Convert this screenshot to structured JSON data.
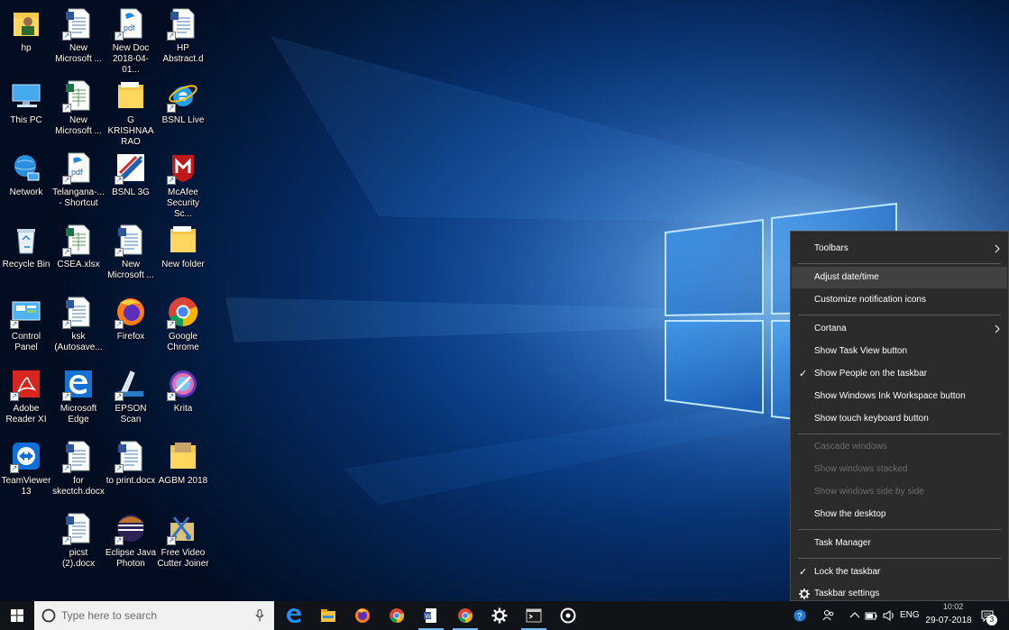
{
  "desktop": {
    "icons": [
      {
        "label": "hp",
        "icon": "user-folder-icon"
      },
      {
        "label": "This PC",
        "icon": "computer-icon"
      },
      {
        "label": "Network",
        "icon": "network-globe-icon"
      },
      {
        "label": "Recycle Bin",
        "icon": "recycle-bin-icon"
      },
      {
        "label": "Control Panel",
        "icon": "control-panel-icon"
      },
      {
        "label": "Adobe Reader XI",
        "icon": "adobe-reader-icon"
      },
      {
        "label": "TeamViewer 13",
        "icon": "teamviewer-icon"
      },
      {
        "label": "New Microsoft ...",
        "icon": "word-document-icon"
      },
      {
        "label": "New Microsoft ...",
        "icon": "excel-document-icon"
      },
      {
        "label": "Telangana-... - Shortcut",
        "icon": "pdf-document-icon"
      },
      {
        "label": "CSEA.xlsx",
        "icon": "excel-document-icon"
      },
      {
        "label": "ksk (Autosave...",
        "icon": "word-document-icon"
      },
      {
        "label": "Microsoft Edge",
        "icon": "edge-icon"
      },
      {
        "label": "for skectch.docx",
        "icon": "word-document-icon"
      },
      {
        "label": "picst (2).docx",
        "icon": "word-document-icon"
      },
      {
        "label": "New Doc 2018-04-01...",
        "icon": "pdf-document-icon"
      },
      {
        "label": "G KRISHNAA RAO",
        "icon": "folder-icon"
      },
      {
        "label": "BSNL 3G",
        "icon": "bsnl-icon"
      },
      {
        "label": "New Microsoft ...",
        "icon": "word-document-icon"
      },
      {
        "label": "Firefox",
        "icon": "firefox-icon"
      },
      {
        "label": "EPSON Scan",
        "icon": "scanner-icon"
      },
      {
        "label": "to print.docx",
        "icon": "word-document-icon"
      },
      {
        "label": "Eclipse Java Photon",
        "icon": "eclipse-icon"
      },
      {
        "label": "HP Abstract.d",
        "icon": "word-document-icon"
      },
      {
        "label": "BSNL Live",
        "icon": "ie-icon"
      },
      {
        "label": "McAfee Security Sc...",
        "icon": "mcafee-icon"
      },
      {
        "label": "New folder",
        "icon": "folder-icon"
      },
      {
        "label": "Google Chrome",
        "icon": "chrome-icon"
      },
      {
        "label": "Krita",
        "icon": "krita-icon"
      },
      {
        "label": "AGBM 2018",
        "icon": "image-folder-icon"
      },
      {
        "label": "Free Video Cutter Joiner",
        "icon": "video-cutter-icon"
      }
    ]
  },
  "context_menu": {
    "items": [
      {
        "label": "Toolbars",
        "submenu": true
      },
      {
        "label": "Adjust date/time",
        "hover": true
      },
      {
        "label": "Customize notification icons"
      },
      {
        "label": "Cortana",
        "submenu": true
      },
      {
        "label": "Show Task View button"
      },
      {
        "label": "Show People on the taskbar",
        "checked": true
      },
      {
        "label": "Show Windows Ink Workspace button"
      },
      {
        "label": "Show touch keyboard button"
      },
      {
        "label": "Cascade windows",
        "disabled": true
      },
      {
        "label": "Show windows stacked",
        "disabled": true
      },
      {
        "label": "Show windows side by side",
        "disabled": true
      },
      {
        "label": "Show the desktop"
      },
      {
        "label": "Task Manager"
      },
      {
        "label": "Lock the taskbar",
        "checked": true
      },
      {
        "label": "Taskbar settings",
        "icon": "gear-icon"
      }
    ]
  },
  "taskbar": {
    "search_placeholder": "Type here to search",
    "apps": [
      "edge-icon",
      "file-explorer-icon",
      "firefox-icon",
      "chrome-icon",
      "word-icon",
      "chrome-icon",
      "settings-icon",
      "terminal-icon",
      "media-icon"
    ],
    "tray": {
      "language": "ENG",
      "time": "10:02",
      "date": "29-07-2018",
      "notification_count": "3"
    }
  },
  "colors": {
    "taskbar": "#101418",
    "menu_bg": "#2b2b2b",
    "menu_hover": "#414141",
    "accent": "#0078d7"
  }
}
